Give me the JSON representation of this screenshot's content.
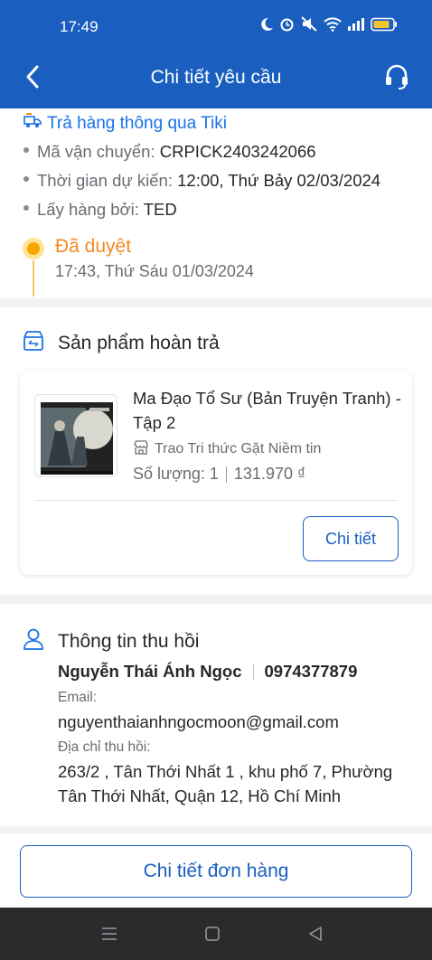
{
  "status_bar": {
    "time": "17:49"
  },
  "header": {
    "title": "Chi tiết yêu cầu"
  },
  "shipping": {
    "title": "Trả hàng thông qua Tiki",
    "rows": [
      {
        "label": "Mã vận chuyển: ",
        "value": "CRPICK2403242066"
      },
      {
        "label": "Thời gian dự kiến: ",
        "value": "12:00, Thứ Bảy 02/03/2024"
      },
      {
        "label": "Lấy hàng bởi: ",
        "value": "TED"
      }
    ],
    "status": {
      "label": "Đã duyệt",
      "time": "17:43, Thứ Sáu 01/03/2024"
    }
  },
  "products": {
    "heading": "Sản phẩm hoàn trả",
    "item": {
      "name": "Ma Đạo Tổ Sư (Bản Truyện Tranh) - Tập 2",
      "shop": "Trao Tri thức Gặt Niềm tin",
      "quantity": "Số lượng: 1",
      "price": "131.970 ₫",
      "detail_label": "Chi tiết"
    }
  },
  "recover": {
    "heading": "Thông tin thu hồi",
    "name": "Nguyễn Thái Ánh Ngọc",
    "phone": "0974377879",
    "email_label": "Email:",
    "email": "nguyenthaianhngocmoon@gmail.com",
    "address_label": "Địa chỉ thu hồi:",
    "address": "263/2 , Tân Thới Nhất 1 , khu phố 7, Phường Tân Thới Nhất, Quận 12, Hồ Chí Minh"
  },
  "footer": {
    "order_detail_label": "Chi tiết đơn hàng"
  },
  "colors": {
    "primary": "#1a5fc0",
    "link": "#1a73e8",
    "status_orange": "#f58a1f"
  }
}
